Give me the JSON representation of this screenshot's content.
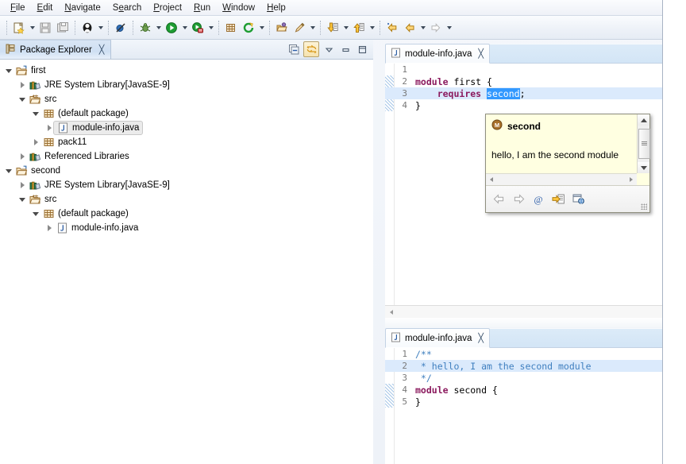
{
  "menubar": {
    "items": [
      {
        "mnemonic": "F",
        "rest": "ile"
      },
      {
        "mnemonic": "E",
        "rest": "dit"
      },
      {
        "mnemonic": "N",
        "rest": "avigate"
      },
      {
        "mnemonic": "S",
        "rest": "earch"
      },
      {
        "mnemonic": "P",
        "rest": "roject"
      },
      {
        "mnemonic": "R",
        "rest": "un"
      },
      {
        "mnemonic": "W",
        "rest": "indow"
      },
      {
        "mnemonic": "H",
        "rest": "elp"
      }
    ]
  },
  "toolbar": {
    "buttons": [
      {
        "name": "new-wizard-icon",
        "label": "New"
      },
      {
        "name": "save-icon",
        "label": "Save"
      },
      {
        "name": "save-all-icon",
        "label": "Save All"
      },
      {
        "name": "print-icon",
        "label": "Print"
      },
      {
        "name": "skip-breakpoints-icon",
        "label": "Skip All Breakpoints"
      },
      {
        "name": "debug-icon",
        "label": "Debug"
      },
      {
        "name": "run-icon",
        "label": "Run"
      },
      {
        "name": "coverage-icon",
        "label": "Coverage"
      },
      {
        "name": "new-java-package-icon",
        "label": "New Java Package"
      },
      {
        "name": "external-tools-icon",
        "label": "External Tools"
      },
      {
        "name": "open-type-icon",
        "label": "Open Type"
      },
      {
        "name": "search-icon",
        "label": "Search"
      },
      {
        "name": "next-annotation-icon",
        "label": "Next Annotation"
      },
      {
        "name": "previous-annotation-icon",
        "label": "Previous Annotation"
      },
      {
        "name": "last-edit-location-icon",
        "label": "Last Edit Location"
      },
      {
        "name": "back-icon",
        "label": "Back"
      },
      {
        "name": "forward-icon",
        "label": "Forward"
      }
    ]
  },
  "explorer": {
    "title": "Package Explorer",
    "close_glyph": "╳",
    "toolbar": [
      {
        "name": "collapse-all-button",
        "label": "Collapse All"
      },
      {
        "name": "link-with-editor-button",
        "label": "Link with Editor"
      },
      {
        "name": "view-menu-button",
        "label": "View Menu"
      },
      {
        "name": "minimize-button",
        "label": "Minimize"
      },
      {
        "name": "maximize-button",
        "label": "Maximize"
      }
    ],
    "tree": [
      {
        "indent": 0,
        "twist": "open",
        "icon": "java-project-icon",
        "label": "first",
        "suffix": "",
        "selected": false
      },
      {
        "indent": 1,
        "twist": "closed",
        "icon": "library-icon",
        "label": "JRE System Library ",
        "suffix": "[JavaSE-9]",
        "selected": false
      },
      {
        "indent": 1,
        "twist": "open",
        "icon": "source-folder-icon",
        "label": "src",
        "suffix": "",
        "selected": false
      },
      {
        "indent": 2,
        "twist": "open",
        "icon": "package-icon",
        "label": "(default package)",
        "suffix": "",
        "selected": false
      },
      {
        "indent": 3,
        "twist": "closed",
        "icon": "java-file-icon",
        "label": "module-info.java",
        "suffix": "",
        "selected": true
      },
      {
        "indent": 2,
        "twist": "closed",
        "icon": "package-icon",
        "label": "pack11",
        "suffix": "",
        "selected": false
      },
      {
        "indent": 1,
        "twist": "closed",
        "icon": "library-icon",
        "label": "Referenced Libraries",
        "suffix": "",
        "selected": false
      },
      {
        "indent": 0,
        "twist": "open",
        "icon": "java-project-icon",
        "label": "second",
        "suffix": "",
        "selected": false
      },
      {
        "indent": 1,
        "twist": "closed",
        "icon": "library-icon",
        "label": "JRE System Library ",
        "suffix": "[JavaSE-9]",
        "selected": false
      },
      {
        "indent": 1,
        "twist": "open",
        "icon": "source-folder-icon",
        "label": "src",
        "suffix": "",
        "selected": false
      },
      {
        "indent": 2,
        "twist": "open",
        "icon": "package-icon",
        "label": "(default package)",
        "suffix": "",
        "selected": false
      },
      {
        "indent": 3,
        "twist": "closed",
        "icon": "java-file-icon",
        "label": "module-info.java",
        "suffix": "",
        "selected": false
      }
    ]
  },
  "editors": {
    "top": {
      "tab_label": "module-info.java",
      "tab_close_glyph": "╳",
      "lines": [
        {
          "no": "1",
          "highlight": false,
          "change": false,
          "tokens": [
            {
              "t": "",
              "cls": "plain"
            }
          ]
        },
        {
          "no": "2",
          "highlight": false,
          "change": true,
          "tokens": [
            {
              "t": "module",
              "cls": "kw"
            },
            {
              "t": " first {",
              "cls": "plain"
            }
          ]
        },
        {
          "no": "3",
          "highlight": true,
          "change": true,
          "tokens": [
            {
              "t": "    ",
              "cls": "plain"
            },
            {
              "t": "requires",
              "cls": "kw"
            },
            {
              "t": " ",
              "cls": "plain"
            },
            {
              "t": "second",
              "cls": "selword"
            },
            {
              "t": ";",
              "cls": "plain"
            }
          ]
        },
        {
          "no": "4",
          "highlight": false,
          "change": true,
          "tokens": [
            {
              "t": "}",
              "cls": "plain"
            }
          ]
        }
      ]
    },
    "bottom": {
      "tab_label": "module-info.java",
      "tab_close_glyph": "╳",
      "lines": [
        {
          "no": "1",
          "highlight": false,
          "change": false,
          "tokens": [
            {
              "t": "/**",
              "cls": "cmt"
            }
          ]
        },
        {
          "no": "2",
          "highlight": true,
          "change": false,
          "tokens": [
            {
              "t": " * hello, I am the second module",
              "cls": "cmt"
            }
          ]
        },
        {
          "no": "3",
          "highlight": false,
          "change": false,
          "tokens": [
            {
              "t": " */",
              "cls": "cmt"
            }
          ]
        },
        {
          "no": "4",
          "highlight": false,
          "change": true,
          "tokens": [
            {
              "t": "module",
              "cls": "kw"
            },
            {
              "t": " second {",
              "cls": "plain"
            }
          ]
        },
        {
          "no": "5",
          "highlight": false,
          "change": true,
          "tokens": [
            {
              "t": "}",
              "cls": "plain"
            }
          ]
        }
      ]
    }
  },
  "popup": {
    "icon_letter": "M",
    "title": "second",
    "description": "hello, I am the second module",
    "toolbar": [
      {
        "name": "back-icon",
        "label": "Back"
      },
      {
        "name": "forward-icon",
        "label": "Forward"
      },
      {
        "name": "at-javadoc-icon",
        "label": "Show in Javadoc"
      },
      {
        "name": "open-declaration-icon",
        "label": "Open Declaration"
      },
      {
        "name": "open-external-browser-icon",
        "label": "Open in Browser"
      }
    ]
  },
  "colors": {
    "keyword": "#8B1A5E",
    "comment": "#3F7FBF",
    "selection": "#3399FF",
    "line_highlight": "#DBEAFC",
    "popup_bg": "#FFFFE1"
  }
}
